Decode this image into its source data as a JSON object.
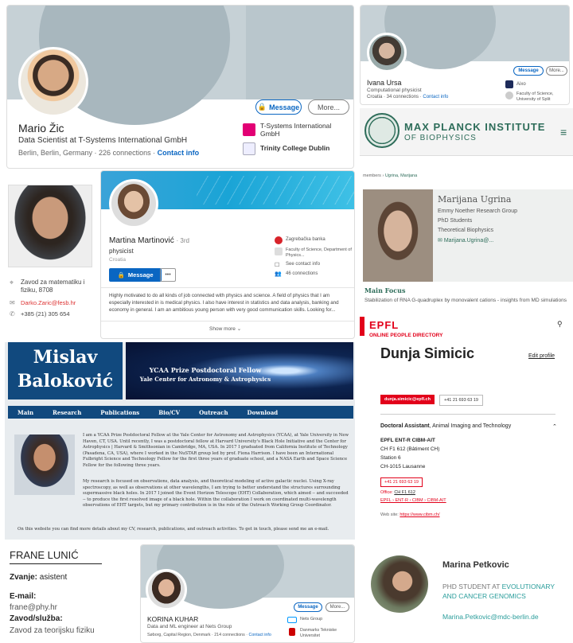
{
  "card1": {
    "name": "Mario Žic",
    "headline": "Data Scientist at T-Systems International GmbH",
    "location": "Berlin, Berlin, Germany",
    "connections": "226 connections",
    "contact": "Contact info",
    "message": "Message",
    "more": "More...",
    "org1": "T-Systems International GmbH",
    "org2": "Trinity College Dublin",
    "org1_logo": "T·Systems"
  },
  "card2": {
    "name": "Ivana Ursa",
    "headline": "Computational physicist",
    "meta": "Croatia · 34 connections ·",
    "contact": "Contact info",
    "message": "Message",
    "more": "More...",
    "org1": "Aixo",
    "org2": "Faculty of Science, University of Split"
  },
  "mpi": {
    "title": "MAX PLANCK INSTITUTE",
    "subtitle": "OF BIOPHYSICS",
    "crumb_a": "members",
    "crumb_b": "Ugrina, Marijana",
    "name": "Marijana Ugrina",
    "line1": "Emmy Noether Research Group",
    "line2": "PhD Students",
    "line3": "Theoretical Biophysics",
    "email": "Marijana.Ugrina@...",
    "focus_title": "Main Focus",
    "focus_text": "Stabilization of RNA G-quadruplex by monovalent cations - insights from MD simulations"
  },
  "darko": {
    "place": "Zavod za matematiku i fiziku, 8708",
    "email": "Darko.Zaric@fesb.hr",
    "phone": "+385 (21) 305 654"
  },
  "martina": {
    "name": "Martina Martinović",
    "degree": "· 3rd",
    "headline": "physicist",
    "location": "Croatia",
    "message": "Message",
    "more": "•••",
    "org1": "Zagrebačka banka",
    "org2": "Faculty of Science, Department of Physics...",
    "contact": "See contact info",
    "connections": "46 connections",
    "about": "Highly motivated to do all kinds of job connected with physics and science. A field of physics that I am especially interested in is medical physics. I also have interest in statistics and data analysis, banking and economy in general. I am an ambitious young person with very good communication skills. Looking for...",
    "show_more": "Show more"
  },
  "mislav": {
    "first": "Mislav",
    "last": "Baloković",
    "banner1": "YCAA Prize Postdoctoral Fellow",
    "banner2": "Yale Center for Astronomy & Astrophysics",
    "nav": [
      "Main",
      "Research",
      "Publications",
      "Bio/CV",
      "Outreach",
      "Download"
    ],
    "p1": "I am a YCAA Prize Postdoctoral Fellow at the Yale Center for Astronomy and Astrophysics (YCAA), at Yale University in New Haven, CT, USA. Until recently, I was a postdoctoral fellow at Harvard University's Black Hole Initiative and the Center for Astrophysics | Harvard & Smithsonian in Cambridge, MA, USA. In 2017 I graduated from California Institute of Technology (Pasadena, CA, USA), where I worked in the NuSTAR group led by prof. Fiona Harrison. I have been an International Fulbright Science and Technology Fellow for the first three years of graduate school, and a NASA Earth and Space Science Fellow for the following three years.",
    "p2": "My research is focused on observations, data analysis, and theoretical modeling of active galactic nuclei. Using X-ray spectroscopy, as well as observations at other wavelengths, I am trying to better understand the structures surrounding supermassive black holes. In 2017 I joined the Event Horizon Telescope (EHT) Collaboration, which aimed -- and succeeded -- to produce the first resolved image of a black hole. Within the collaboration I work on coordinated multi-wavelength observations of EHT targets, but my primary contribution is in the role of the Outreach Working Group Coordinator.",
    "p3": "On this website you can find more details about my CV, research, publications, and outreach activities. To get in touch, please send me an e-mail."
  },
  "epfl": {
    "logo": "EPFL",
    "directory": "ONLINE PEOPLE DIRECTORY",
    "name": "Dunja Simicic",
    "edit": "Edit profile",
    "email": "dunja.simicic@epfl.ch",
    "phone": "+41 21 693 63 19",
    "role": "Doctoral Assistant",
    "role_unit": ", Animal Imaging and Technology",
    "addr": [
      "EPFL ENT-R CIBM-AIT",
      "CH F1 612 (Bâtiment CH)",
      "Station 6",
      "CH-1015 Lausanne"
    ],
    "phone2": "+41 21 693 63 19",
    "office_label": "Office:",
    "office": "CH F1 612",
    "path": "EPFL › ENT-R › CIBM › CIBM-AIT",
    "web_label": "Web site:",
    "web": "https://www.cibm.ch/"
  },
  "frane": {
    "name": "FRANE LUNIĆ",
    "zvanje_label": "Zvanje:",
    "zvanje": "asistent",
    "email_label": "E-mail:",
    "email": "frane@phy.hr",
    "zavod_label": "Zavod/služba:",
    "zavod": "Zavod za teorijsku fiziku"
  },
  "korina": {
    "name": "KORINA KUHAR",
    "headline": "Data and ML engineer at Nets Group",
    "meta": "Søborg, Capital Region, Denmark · 214 connections ·",
    "contact": "Contact info",
    "message": "Message",
    "more": "More...",
    "org1": "Nets Group",
    "org2": "Danmarks Tekniske Universitet"
  },
  "petkovic": {
    "name": "Marina Petkovic",
    "role1": "PHD STUDENT AT",
    "role1b": "EVOLUTIONARY",
    "role2": "AND CANCER GENOMICS",
    "email": "Marina.Petkovic@mdc-berlin.de"
  }
}
